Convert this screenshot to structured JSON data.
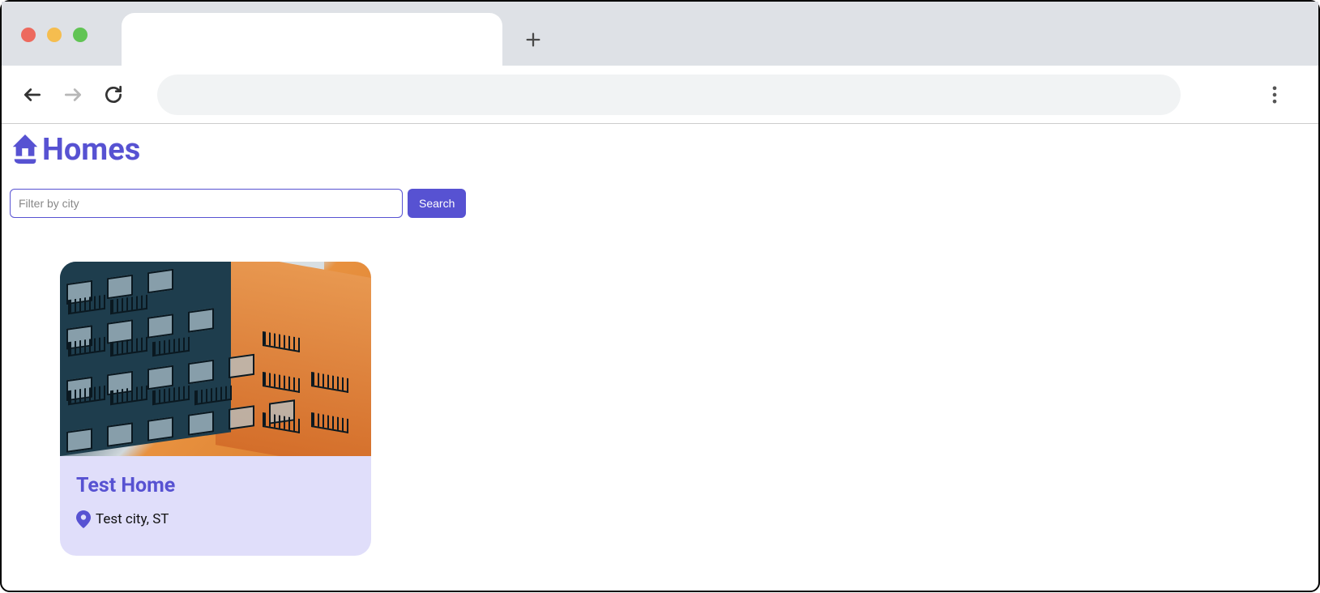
{
  "brand": {
    "name": "Homes",
    "color": "#5752d2"
  },
  "search": {
    "placeholder": "Filter by city",
    "value": "",
    "button_label": "Search"
  },
  "listings": [
    {
      "title": "Test Home",
      "location": "Test city, ST"
    }
  ]
}
